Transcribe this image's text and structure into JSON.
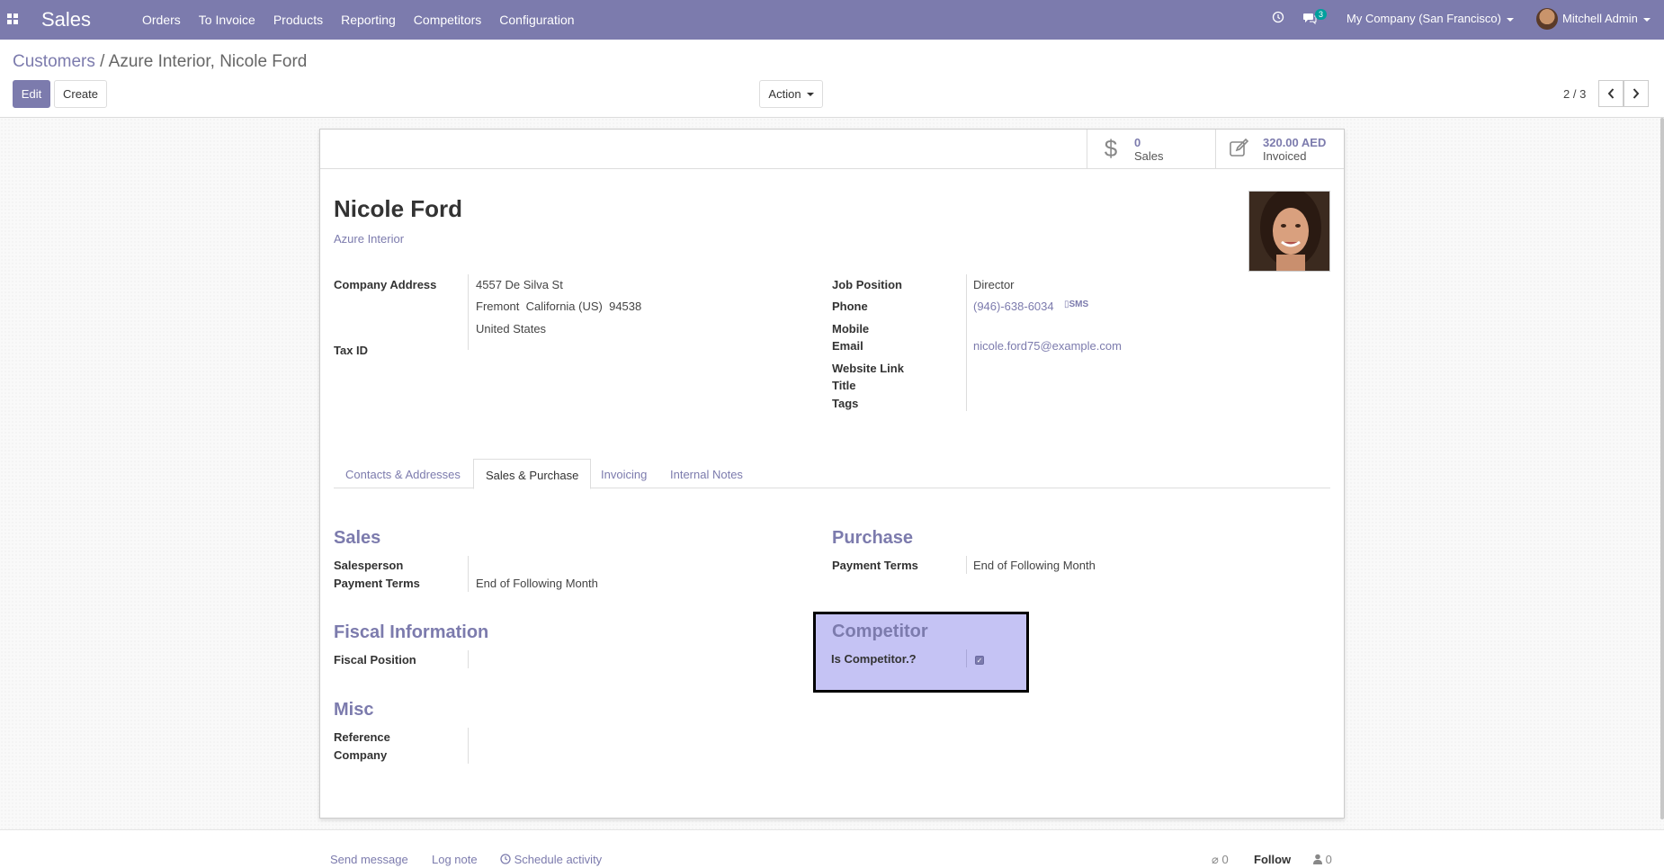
{
  "navbar": {
    "app_name": "Sales",
    "menu": [
      "Orders",
      "To Invoice",
      "Products",
      "Reporting",
      "Competitors",
      "Configuration"
    ],
    "messages_count": "3",
    "company": "My Company (San Francisco)",
    "user": "Mitchell Admin"
  },
  "breadcrumb": {
    "parent": "Customers",
    "separator": "/",
    "current": "Azure Interior, Nicole Ford"
  },
  "buttons": {
    "edit": "Edit",
    "create": "Create",
    "action": "Action"
  },
  "pager": {
    "value": "2 / 3"
  },
  "stats": [
    {
      "icon": "dollar-icon",
      "value": "0",
      "label": "Sales"
    },
    {
      "icon": "edit-icon",
      "value": "320.00 AED",
      "label": "Invoiced"
    }
  ],
  "partner": {
    "name": "Nicole Ford",
    "company": "Azure Interior"
  },
  "left_fields": {
    "company_address_label": "Company Address",
    "street": "4557 De Silva St",
    "city_line": "Fremont  California (US)  94538",
    "country": "United States",
    "tax_id_label": "Tax ID"
  },
  "right_fields": {
    "job_position_label": "Job Position",
    "job_position": "Director",
    "phone_label": "Phone",
    "phone": "(946)-638-6034",
    "sms": "SMS",
    "mobile_label": "Mobile",
    "email_label": "Email",
    "email": "nicole.ford75@example.com",
    "website_label": "Website Link",
    "title_label": "Title",
    "tags_label": "Tags"
  },
  "tabs": [
    "Contacts & Addresses",
    "Sales & Purchase",
    "Invoicing",
    "Internal Notes"
  ],
  "active_tab": "Sales & Purchase",
  "sales_group": {
    "title": "Sales",
    "salesperson_label": "Salesperson",
    "payment_terms_label": "Payment Terms",
    "payment_terms": "End of Following Month"
  },
  "purchase_group": {
    "title": "Purchase",
    "payment_terms_label": "Payment Terms",
    "payment_terms": "End of Following Month"
  },
  "fiscal_group": {
    "title": "Fiscal Information",
    "fiscal_position_label": "Fiscal Position"
  },
  "competitor_group": {
    "title": "Competitor",
    "is_competitor_label": "Is Competitor.?",
    "is_competitor": true
  },
  "misc_group": {
    "title": "Misc",
    "reference_label": "Reference",
    "company_label": "Company"
  },
  "chatter": {
    "send_message": "Send message",
    "log_note": "Log note",
    "schedule_activity": "Schedule activity",
    "attachments_count": "0",
    "follow": "Follow",
    "followers_count": "0"
  },
  "colors": {
    "brand": "#7c7bad",
    "highlight": "#c5c3f4",
    "badge": "#00a09d"
  }
}
